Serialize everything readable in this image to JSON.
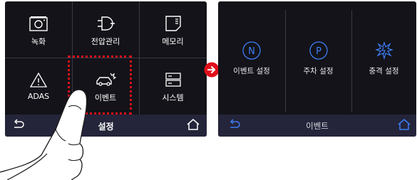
{
  "screen1": {
    "menu": [
      {
        "label": "녹화",
        "icon": "camera-icon"
      },
      {
        "label": "전압관리",
        "icon": "plug-icon"
      },
      {
        "label": "메모리",
        "icon": "memory-card-icon"
      },
      {
        "label": "ADAS",
        "icon": "warning-triangle-icon"
      },
      {
        "label": "이벤트",
        "icon": "car-crash-icon"
      },
      {
        "label": "시스템",
        "icon": "server-icon"
      }
    ],
    "bottom": {
      "title": "설정",
      "back_icon": "back-arrow-icon",
      "home_icon": "home-icon"
    }
  },
  "screen2": {
    "menu": [
      {
        "label": "이벤트 설정",
        "icon": "n-circle-icon",
        "glyph": "N"
      },
      {
        "label": "주차 설정",
        "icon": "p-circle-icon",
        "glyph": "P"
      },
      {
        "label": "충격 설정",
        "icon": "impact-icon"
      }
    ],
    "bottom": {
      "title": "이벤트",
      "back_icon": "back-arrow-icon",
      "home_icon": "home-icon"
    }
  },
  "colors": {
    "screen_bg": "#131319",
    "bar_bg": "#24243a",
    "highlight": "#e0101a",
    "accent": "#3d7df5"
  }
}
